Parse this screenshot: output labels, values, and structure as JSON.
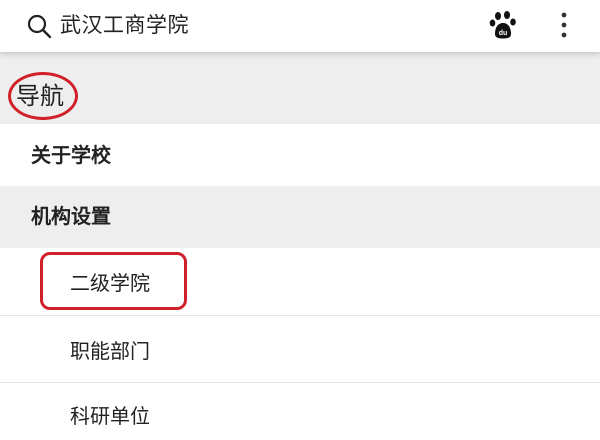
{
  "search_bar": {
    "query": "武汉工商学院",
    "search_icon": "search-icon",
    "baidu_icon": "baidu-paw-icon",
    "more_icon": "more-vertical-icon"
  },
  "navigation": {
    "header": "导航",
    "items": [
      {
        "label": "关于学校",
        "level": 1
      },
      {
        "label": "机构设置",
        "level": 1,
        "expanded": true
      },
      {
        "label": "二级学院",
        "level": 2
      },
      {
        "label": "职能部门",
        "level": 2
      },
      {
        "label": "科研单位",
        "level": 2
      }
    ]
  },
  "colors": {
    "annotation": "#d0202a",
    "section_background": "#eeeeee",
    "text": "#222222"
  }
}
